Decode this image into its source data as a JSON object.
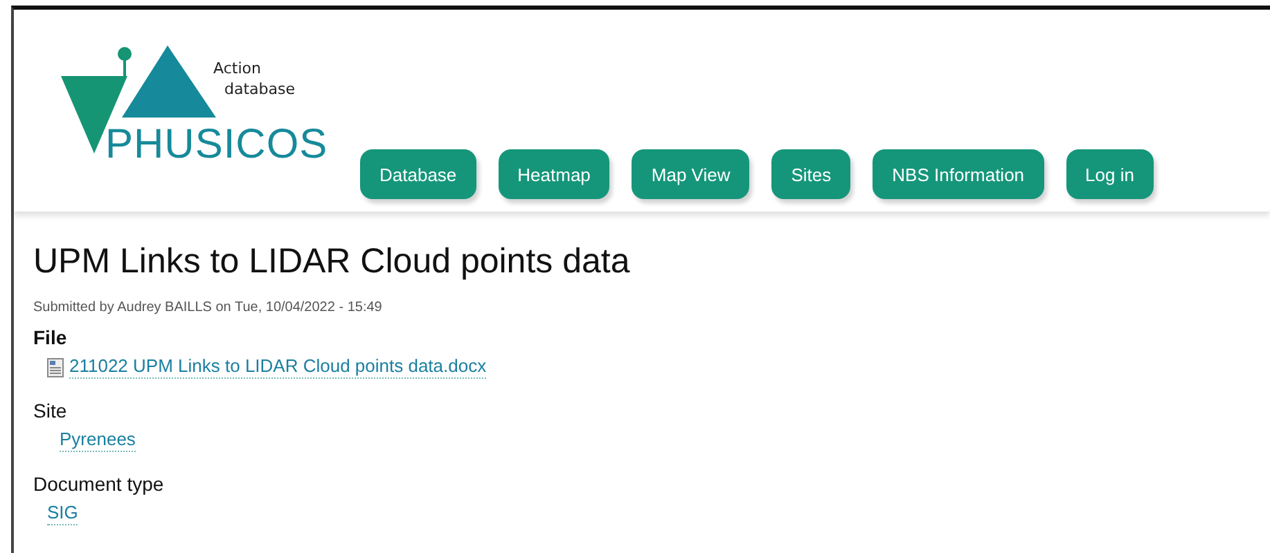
{
  "logo": {
    "caption_lines": [
      "Action",
      "database"
    ],
    "wordmark": "PHUSICOS"
  },
  "nav": [
    {
      "label": "Database"
    },
    {
      "label": "Heatmap"
    },
    {
      "label": "Map View"
    },
    {
      "label": "Sites"
    },
    {
      "label": "NBS Information"
    },
    {
      "label": "Log in"
    }
  ],
  "title": "UPM Links to LIDAR Cloud points data",
  "submitted": "Submitted by Audrey BAILLS on Tue, 10/04/2022 - 15:49",
  "fields": [
    {
      "kind": "file",
      "label": "File",
      "value": "211022 UPM Links to LIDAR Cloud points data.docx"
    },
    {
      "kind": "site",
      "label": "Site",
      "value": "Pyrenees"
    },
    {
      "kind": "type",
      "label": "Document type",
      "value": "SIG"
    }
  ]
}
